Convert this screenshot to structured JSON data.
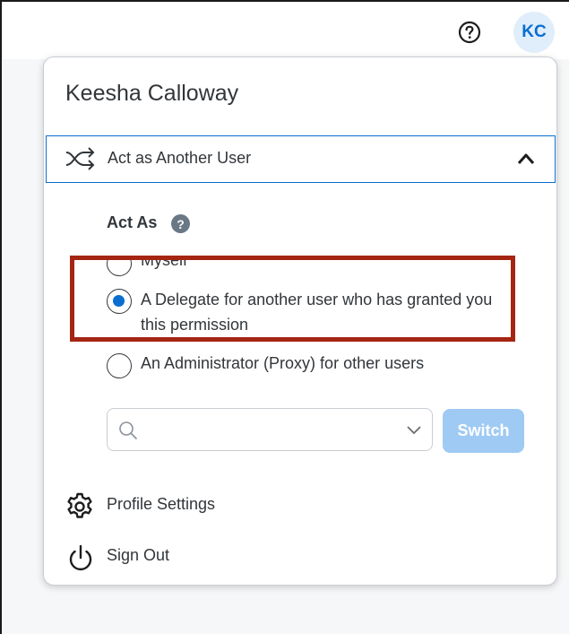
{
  "header": {
    "help_icon": "question-circle-icon",
    "avatar_initials": "KC",
    "avatar_bg": "#e0eefb",
    "accent": "#0a6ed1"
  },
  "profile_menu": {
    "user_name": "Keesha Calloway",
    "act_as_section": {
      "label": "Act as Another User",
      "icon": "shuffle-icon",
      "expanded": true
    },
    "act_as": {
      "title": "Act As",
      "options": [
        {
          "label": "Myself",
          "selected": false
        },
        {
          "label": "A Delegate for another user who has granted you this permission",
          "selected": true
        },
        {
          "label": "An Administrator (Proxy) for other users",
          "selected": false
        }
      ],
      "search_value": "",
      "switch_label": "Switch",
      "switch_enabled": false
    },
    "profile_settings_label": "Profile Settings",
    "sign_out_label": "Sign Out",
    "highlight_color": "#a42512"
  }
}
